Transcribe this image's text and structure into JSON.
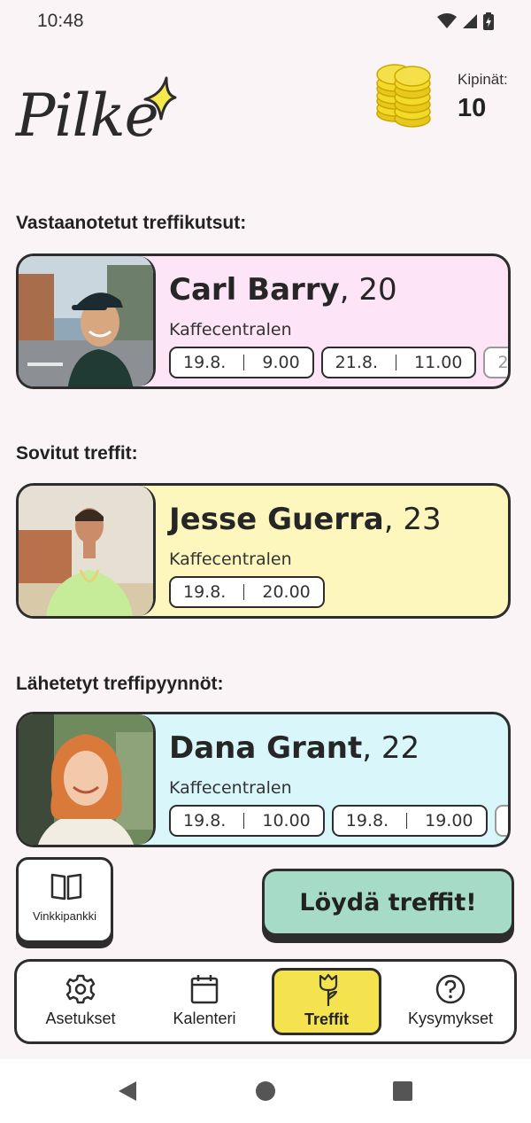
{
  "status": {
    "time": "10:48"
  },
  "header": {
    "app_name": "Pilke",
    "kipinat_label": "Kipinät:",
    "kipinat_value": "10"
  },
  "sections": {
    "received": "Vastaanotetut treffikutsut:",
    "agreed": "Sovitut treffit:",
    "sent": "Lähetetyt treffipyynnöt:"
  },
  "cards": [
    {
      "name": "Carl Barry",
      "age": ", 20",
      "place": "Kaffecentralen",
      "color": "#fde4f6",
      "slots": [
        {
          "date": "19.8.",
          "time": "9.00"
        },
        {
          "date": "21.8.",
          "time": "11.00"
        },
        {
          "date": "2",
          "time": ""
        }
      ]
    },
    {
      "name": "Jesse Guerra",
      "age": ", 23",
      "place": "Kaffecentralen",
      "color": "#fdf6bd",
      "slots": [
        {
          "date": "19.8.",
          "time": "20.00"
        }
      ]
    },
    {
      "name": "Dana Grant",
      "age": ", 22",
      "place": "Kaffecentralen",
      "color": "#d9f7fa",
      "slots": [
        {
          "date": "19.8.",
          "time": "10.00"
        },
        {
          "date": "19.8.",
          "time": "19.00"
        },
        {
          "date": "",
          "time": ""
        }
      ]
    }
  ],
  "actions": {
    "tips": "Vinkkipankki",
    "find": "Löydä treffit!"
  },
  "nav": [
    {
      "label": "Asetukset",
      "icon": "gear-icon"
    },
    {
      "label": "Kalenteri",
      "icon": "calendar-icon"
    },
    {
      "label": "Treffit",
      "icon": "rose-icon",
      "active": true
    },
    {
      "label": "Kysymykset",
      "icon": "question-icon"
    }
  ],
  "colors": {
    "accent": "#f5e24f",
    "find_button": "#a6dcc7",
    "background": "#fbf4f6"
  }
}
